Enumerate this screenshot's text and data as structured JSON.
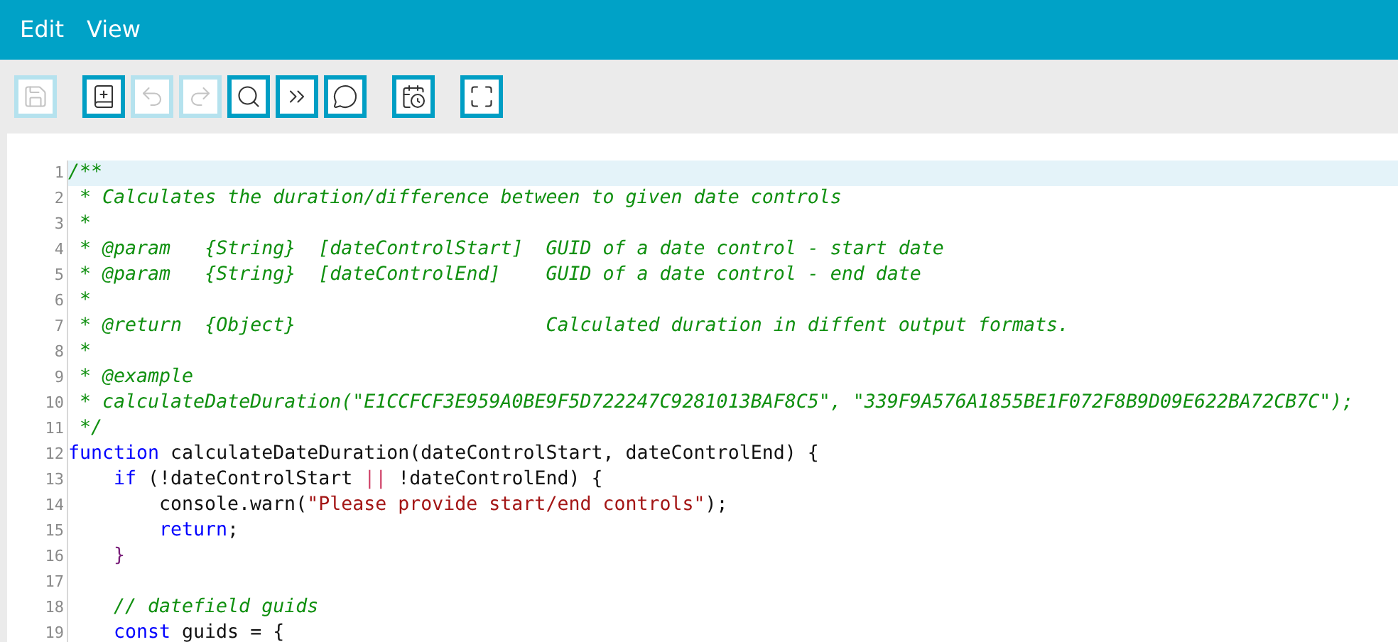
{
  "menu": [
    {
      "label": "Edit"
    },
    {
      "label": "View"
    }
  ],
  "toolbar": {
    "groups": [
      [
        {
          "disabled": true
        }
      ],
      [
        {
          "disabled": false
        },
        {
          "disabled": true
        },
        {
          "disabled": true
        },
        {
          "disabled": false
        },
        {
          "disabled": false
        },
        {
          "disabled": false
        }
      ],
      [
        {
          "disabled": false
        }
      ],
      [
        {
          "disabled": false
        }
      ]
    ]
  },
  "editor": {
    "lines": [
      {
        "number": "1",
        "current": true,
        "tokens": [
          {
            "kind": "comment",
            "text": "/**"
          }
        ]
      },
      {
        "number": "2",
        "current": false,
        "tokens": [
          {
            "kind": "comment",
            "text": " * Calculates the duration/difference between to given date controls"
          }
        ]
      },
      {
        "number": "3",
        "current": false,
        "tokens": [
          {
            "kind": "comment",
            "text": " *"
          }
        ]
      },
      {
        "number": "4",
        "current": false,
        "tokens": [
          {
            "kind": "comment",
            "text": " * @param   {String}  [dateControlStart]  GUID of a date control - start date"
          }
        ]
      },
      {
        "number": "5",
        "current": false,
        "tokens": [
          {
            "kind": "comment",
            "text": " * @param   {String}  [dateControlEnd]    GUID of a date control - end date"
          }
        ]
      },
      {
        "number": "6",
        "current": false,
        "tokens": [
          {
            "kind": "comment",
            "text": " *"
          }
        ]
      },
      {
        "number": "7",
        "current": false,
        "tokens": [
          {
            "kind": "comment",
            "text": " * @return  {Object}                      Calculated duration in diffent output formats."
          }
        ]
      },
      {
        "number": "8",
        "current": false,
        "tokens": [
          {
            "kind": "comment",
            "text": " *"
          }
        ]
      },
      {
        "number": "9",
        "current": false,
        "tokens": [
          {
            "kind": "comment",
            "text": " * @example"
          }
        ]
      },
      {
        "number": "10",
        "current": false,
        "tokens": [
          {
            "kind": "comment",
            "text": " * calculateDateDuration(\"E1CCFCF3E959A0BE9F5D722247C9281013BAF8C5\", \"339F9A576A1855BE1F072F8B9D09E622BA72CB7C\");"
          }
        ]
      },
      {
        "number": "11",
        "current": false,
        "tokens": [
          {
            "kind": "comment",
            "text": " */"
          }
        ]
      },
      {
        "number": "12",
        "current": false,
        "tokens": [
          {
            "kind": "keyword",
            "text": "function"
          },
          {
            "kind": "plain",
            "text": " calculateDateDuration(dateControlStart, dateControlEnd) {"
          }
        ],
        "children": [
          {
            "number": "13",
            "current": false,
            "tokens": [
              {
                "kind": "keyword",
                "text": "if"
              },
              {
                "kind": "plain",
                "text": " (!dateControlStart "
              },
              {
                "kind": "operator",
                "text": "||"
              },
              {
                "kind": "plain",
                "text": " !dateControlEnd) {"
              }
            ],
            "children": [
              {
                "number": "14",
                "current": false,
                "tokens": [
                  {
                    "kind": "plain",
                    "text": "console.warn("
                  },
                  {
                    "kind": "string",
                    "text": "\"Please provide start/end controls\""
                  },
                  {
                    "kind": "plain",
                    "text": ");"
                  }
                ]
              },
              {
                "number": "15",
                "current": false,
                "tokens": [
                  {
                    "kind": "keyword",
                    "text": "return"
                  },
                  {
                    "kind": "plain",
                    "text": ";"
                  }
                ]
              }
            ]
          },
          {
            "number": "16",
            "current": false,
            "tokens": [
              {
                "kind": "bracket",
                "text": "}"
              }
            ]
          },
          {
            "number": "17",
            "current": false
          },
          {
            "number": "18",
            "current": false,
            "tokens": [
              {
                "kind": "comment",
                "text": "// datefield guids"
              }
            ]
          },
          {
            "number": "19",
            "current": false,
            "tokens": [
              {
                "kind": "keyword",
                "text": "const"
              },
              {
                "kind": "plain",
                "text": " guids = {"
              }
            ]
          }
        ]
      }
    ]
  }
}
